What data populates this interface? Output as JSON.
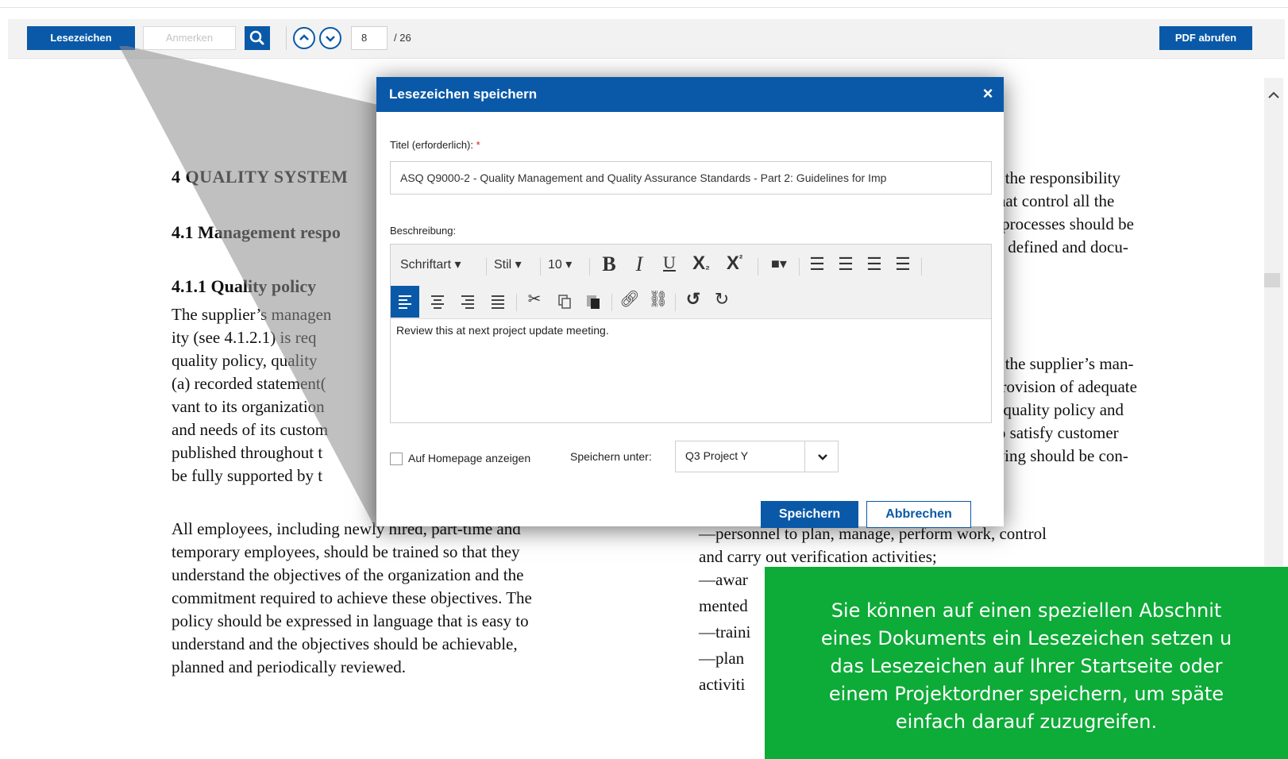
{
  "toolbar": {
    "bookmark_label": "Lesezeichen",
    "annotate_label": "Anmerken",
    "page_current": "8",
    "page_total": "/ 26",
    "pdf_label": "PDF abrufen"
  },
  "document": {
    "heading_4": "4 QUALITY SYSTEM",
    "heading_41": "4.1 Management respo",
    "heading_411": "4.1.1 Quality policy",
    "left_lines_dimmed": [
      "The supplier’s managen",
      "ity (see 4.1.2.1) is req",
      "quality policy, quality",
      "(a) recorded statement(",
      "vant to its organization",
      "and needs of its custom",
      "published throughout t",
      "be fully supported by t"
    ],
    "left_para2": [
      "All employees, including newly hired, part-time and",
      "temporary employees, should be trained so that they",
      "understand the objectives of the organization and the",
      "commitment required to achieve these objectives. The",
      "policy should be expressed in language that is easy to",
      "understand and the objectives should be achievable,",
      "planned and periodically reviewed."
    ],
    "right_lines_top": [
      "g the responsibility",
      "that control all the",
      "l processes should be",
      "ts defined and docu-"
    ],
    "right_lines_mid": [
      "y the supplier’s man-",
      "provision of adequate",
      "s quality policy and",
      "to satisfy customer",
      "wing should be con-"
    ],
    "right_lines_bottom": [
      "—personnel to plan, manage, perform work, control",
      "and carry out verification activities;",
      "—awar",
      "mented",
      "—traini",
      "—plan",
      "activiti"
    ]
  },
  "dialog": {
    "title": "Lesezeichen speichern",
    "title_label": "Titel (erforderlich):",
    "required_mark": "*",
    "title_value": "ASQ Q9000-2 - Quality Management and Quality Assurance Standards - Part 2: Guidelines for Imp",
    "description_label": "Beschreibung:",
    "editor": {
      "font_label": "Schriftart",
      "style_label": "Stil",
      "size_label": "10",
      "body_text": "Review this at next project update meeting."
    },
    "homepage_checkbox_label": "Auf Homepage anzeigen",
    "homepage_checked": false,
    "save_under_label": "Speichern unter:",
    "save_under_value": "Q3 Project Y",
    "save_button": "Speichern",
    "cancel_button": "Abbrechen"
  },
  "callout": {
    "lines": [
      "Sie können auf einen speziellen Abschnit",
      "eines Dokuments ein Lesezeichen setzen u",
      "das Lesezeichen auf Ihrer Startseite oder",
      "einem Projektordner speichern, um späte",
      "einfach darauf zuzugreifen."
    ],
    "background_color": "#0dab37"
  },
  "colors": {
    "accent": "#0a59a8"
  }
}
